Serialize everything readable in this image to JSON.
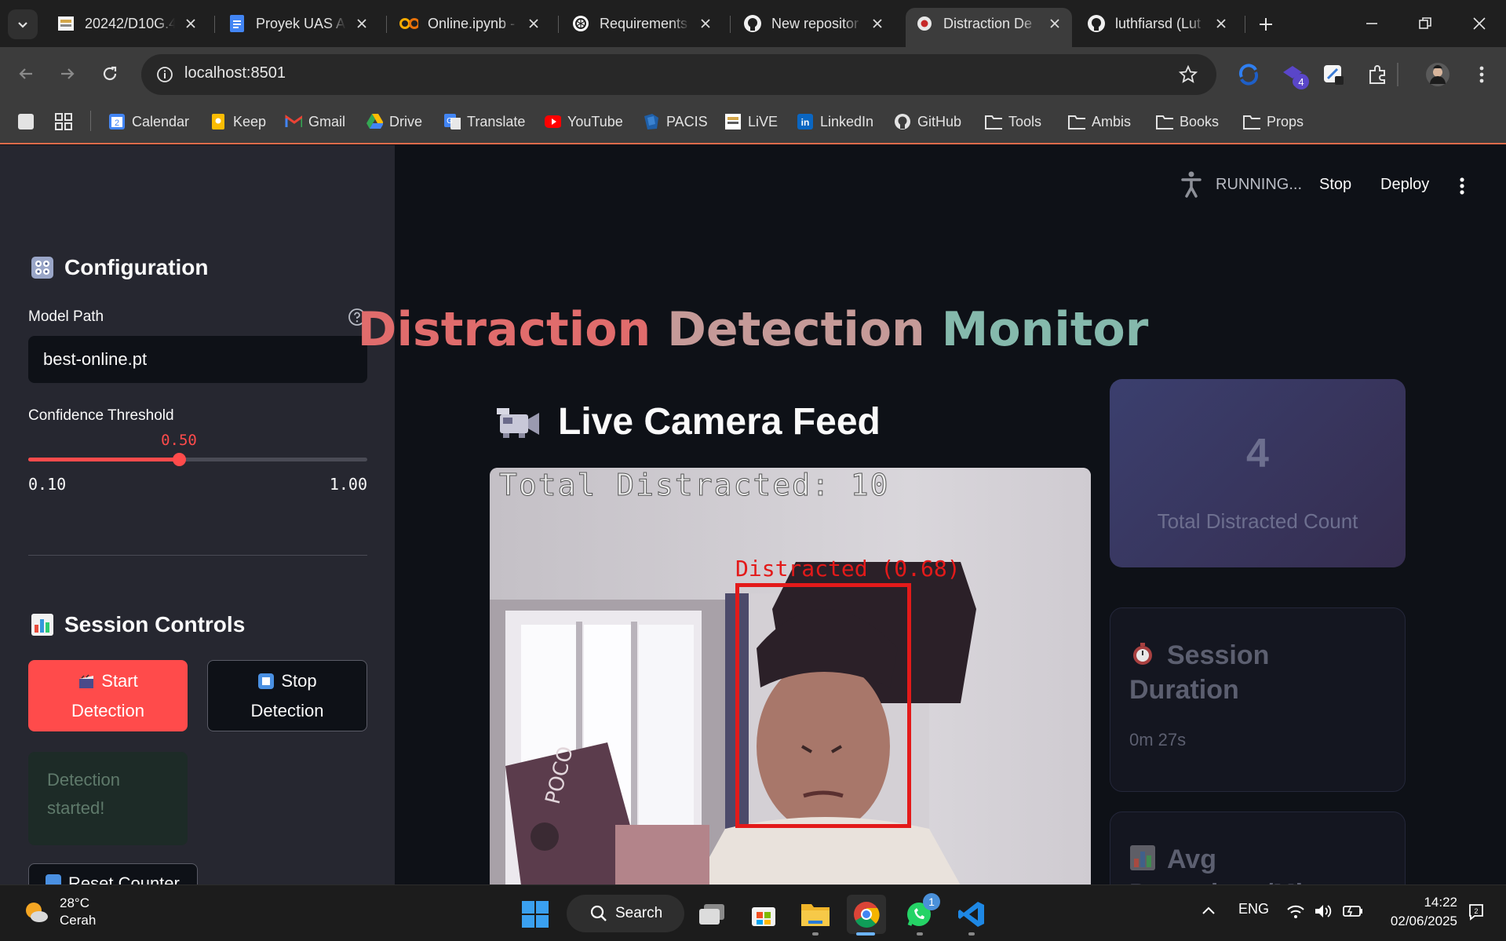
{
  "browser": {
    "tabs": [
      {
        "title": "20242/D10G.4",
        "icon": "university-icon"
      },
      {
        "title": "Proyek UAS AI",
        "icon": "docs-icon"
      },
      {
        "title": "Online.ipynb -",
        "icon": "colab-icon"
      },
      {
        "title": "Requirements",
        "icon": "openai-icon"
      },
      {
        "title": "New repositor",
        "icon": "github-icon"
      },
      {
        "title": "Distraction De",
        "icon": "streamlit-icon",
        "active": true
      },
      {
        "title": "luthfiarsd (Lut",
        "icon": "github-icon"
      }
    ],
    "url": "localhost:8501",
    "extensions_badge": "4",
    "bookmarks": [
      {
        "label": "Calendar",
        "icon": "calendar-icon"
      },
      {
        "label": "Keep",
        "icon": "keep-icon"
      },
      {
        "label": "Gmail",
        "icon": "gmail-icon"
      },
      {
        "label": "Drive",
        "icon": "drive-icon"
      },
      {
        "label": "Translate",
        "icon": "translate-icon"
      },
      {
        "label": "YouTube",
        "icon": "youtube-icon"
      },
      {
        "label": "PACIS",
        "icon": "pacis-icon"
      },
      {
        "label": "LiVE",
        "icon": "live-icon"
      },
      {
        "label": "LinkedIn",
        "icon": "linkedin-icon"
      },
      {
        "label": "GitHub",
        "icon": "github-icon"
      },
      {
        "label": "Tools",
        "icon": "folder-icon"
      },
      {
        "label": "Ambis",
        "icon": "folder-icon"
      },
      {
        "label": "Books",
        "icon": "folder-icon"
      },
      {
        "label": "Props",
        "icon": "folder-icon"
      }
    ]
  },
  "app_header": {
    "status": "RUNNING...",
    "stop_label": "Stop",
    "deploy_label": "Deploy"
  },
  "sidebar": {
    "config_heading": "Configuration",
    "model_path_label": "Model Path",
    "model_path_value": "best-online.pt",
    "threshold_label": "Confidence Threshold",
    "threshold_value": "0.50",
    "threshold": {
      "min": 0.1,
      "max": 1.0,
      "value": 0.5
    },
    "threshold_min_label": "0.10",
    "threshold_max_label": "1.00",
    "session_heading": "Session Controls",
    "start_line1": "Start",
    "start_line2": "Detection",
    "stop_line1": "Stop",
    "stop_line2": "Detection",
    "status_message_line1": "Detection",
    "status_message_line2": "started!",
    "reset_label": "Reset Counter"
  },
  "main": {
    "title_part1": "Distraction",
    "title_part2": "Detection",
    "title_part3": "Monitor",
    "feed_heading": "Live Camera Feed",
    "overlay_text": "Total Distracted: 10",
    "detection_label": "Distracted (0.68)",
    "metric_total_value": "4",
    "metric_total_label": "Total Distracted Count",
    "session_title_line1": "Session",
    "session_title_line2": "Duration",
    "session_value": "0m 27s",
    "avg_title_line1": "Avg",
    "avg_title_line2": "Detections/Min"
  },
  "taskbar": {
    "temperature": "28°C",
    "weather": "Cerah",
    "search_label": "Search",
    "language": "ENG",
    "time": "14:22",
    "date": "02/06/2025",
    "whatsapp_badge": "1"
  },
  "colors": {
    "accent": "#ff4b4b",
    "sidebar_bg": "#262730",
    "main_bg": "#0e1117",
    "detection_box": "#e31a1a"
  }
}
